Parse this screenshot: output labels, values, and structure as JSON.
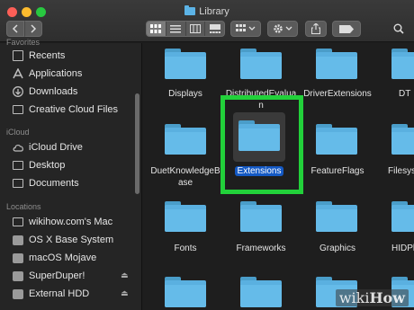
{
  "window": {
    "title": "Library"
  },
  "toolbar": {
    "back_icon": "chevron-left-icon",
    "forward_icon": "chevron-right-icon",
    "view_modes": [
      "icon-view",
      "list-view",
      "column-view",
      "gallery-view"
    ],
    "active_view": "icon-view"
  },
  "sidebar": {
    "favorites_header": "Favorites",
    "favorites": [
      {
        "label": "Recents",
        "icon": "recents-icon"
      },
      {
        "label": "Applications",
        "icon": "applications-icon"
      },
      {
        "label": "Downloads",
        "icon": "downloads-icon"
      },
      {
        "label": "Creative Cloud Files",
        "icon": "folder-icon"
      }
    ],
    "icloud_header": "iCloud",
    "icloud": [
      {
        "label": "iCloud Drive",
        "icon": "cloud-icon"
      },
      {
        "label": "Desktop",
        "icon": "desktop-icon"
      },
      {
        "label": "Documents",
        "icon": "document-icon"
      }
    ],
    "locations_header": "Locations",
    "locations": [
      {
        "label": "wikihow.com's Mac",
        "icon": "computer-icon"
      },
      {
        "label": "OS X Base System",
        "icon": "drive-icon"
      },
      {
        "label": "macOS Mojave",
        "icon": "drive-icon"
      },
      {
        "label": "SuperDuper!",
        "icon": "drive-icon",
        "eject": true
      },
      {
        "label": "External HDD",
        "icon": "drive-icon",
        "eject": true
      }
    ]
  },
  "main": {
    "folders": [
      {
        "label": "Displays"
      },
      {
        "label": "DistributedEvaluation"
      },
      {
        "label": "DriverExtensions"
      },
      {
        "label": "DT"
      },
      {
        "label": "DuetKnowledgeBase"
      },
      {
        "label": "Extensions",
        "selected": true
      },
      {
        "label": "FeatureFlags"
      },
      {
        "label": "Filesys"
      },
      {
        "label": "Fonts"
      },
      {
        "label": "Frameworks"
      },
      {
        "label": "Graphics"
      },
      {
        "label": "HIDPl"
      }
    ]
  },
  "folder_extra": {
    "row1_label_1b": "DistributedEvalua",
    "row1_label_1c": "n",
    "row2_label_0a": "DuetKnowledgeB",
    "row2_label_0b": "ase"
  },
  "watermark": {
    "prefix": "wiki",
    "suffix": "How"
  },
  "colors": {
    "highlight": "#22d13a",
    "selection": "#1459c4",
    "folder": "#5ab0e0"
  }
}
